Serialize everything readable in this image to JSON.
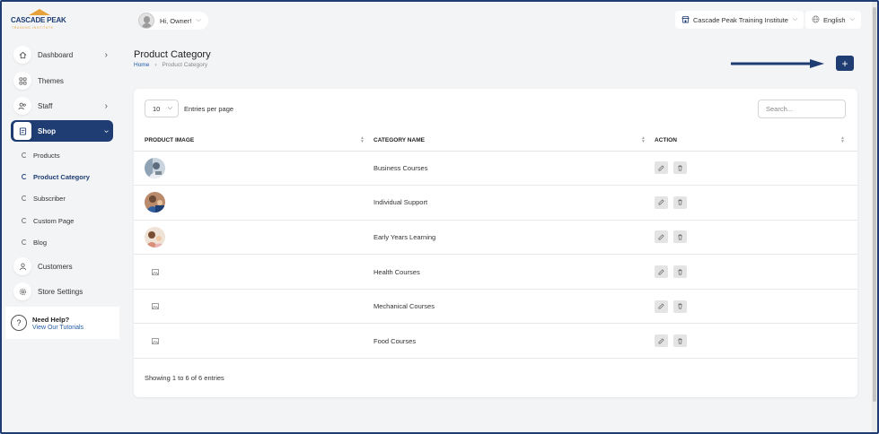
{
  "brand": {
    "name": "CASCADE PEAK",
    "tagline": "TRAINING INSTITUTE"
  },
  "sidebar": {
    "items": [
      {
        "label": "Dashboard",
        "icon": "home-icon",
        "has_children": true
      },
      {
        "label": "Themes",
        "icon": "themes-icon",
        "has_children": false
      },
      {
        "label": "Staff",
        "icon": "users-icon",
        "has_children": true
      },
      {
        "label": "Shop",
        "icon": "shop-icon",
        "has_children": true,
        "active": true
      },
      {
        "label": "Customers",
        "icon": "user-icon",
        "has_children": false
      },
      {
        "label": "Store Settings",
        "icon": "settings-icon",
        "has_children": false
      }
    ],
    "shop_sub_items": [
      {
        "label": "Products"
      },
      {
        "label": "Product Category",
        "active": true
      },
      {
        "label": "Subscriber"
      },
      {
        "label": "Custom Page"
      },
      {
        "label": "Blog"
      }
    ],
    "help": {
      "title": "Need Help?",
      "link": "View Our Tutorials"
    }
  },
  "topbar": {
    "greeting": "Hi, Owner!",
    "institute": "Cascade Peak Training Institute",
    "language": "English"
  },
  "page": {
    "title": "Product Category",
    "breadcrumb": {
      "home": "Home",
      "current": "Product Category"
    },
    "add_label": "+"
  },
  "table": {
    "entries_value": "10",
    "entries_label": "Entries per page",
    "search_placeholder": "Search...",
    "columns": [
      "PRODUCT IMAGE",
      "CATEGORY NAME",
      "ACTION"
    ],
    "rows": [
      {
        "category": "Business Courses",
        "image": "photo"
      },
      {
        "category": "Individual Support",
        "image": "photo"
      },
      {
        "category": "Early Years Learning",
        "image": "photo"
      },
      {
        "category": "Health Courses",
        "image": "placeholder"
      },
      {
        "category": "Mechanical Courses",
        "image": "placeholder"
      },
      {
        "category": "Food Courses",
        "image": "placeholder"
      }
    ],
    "footer": "Showing 1 to 6 of 6 entries"
  },
  "colors": {
    "primary": "#1f3d73",
    "accent": "#e6a33b",
    "link": "#1f5aa6"
  }
}
